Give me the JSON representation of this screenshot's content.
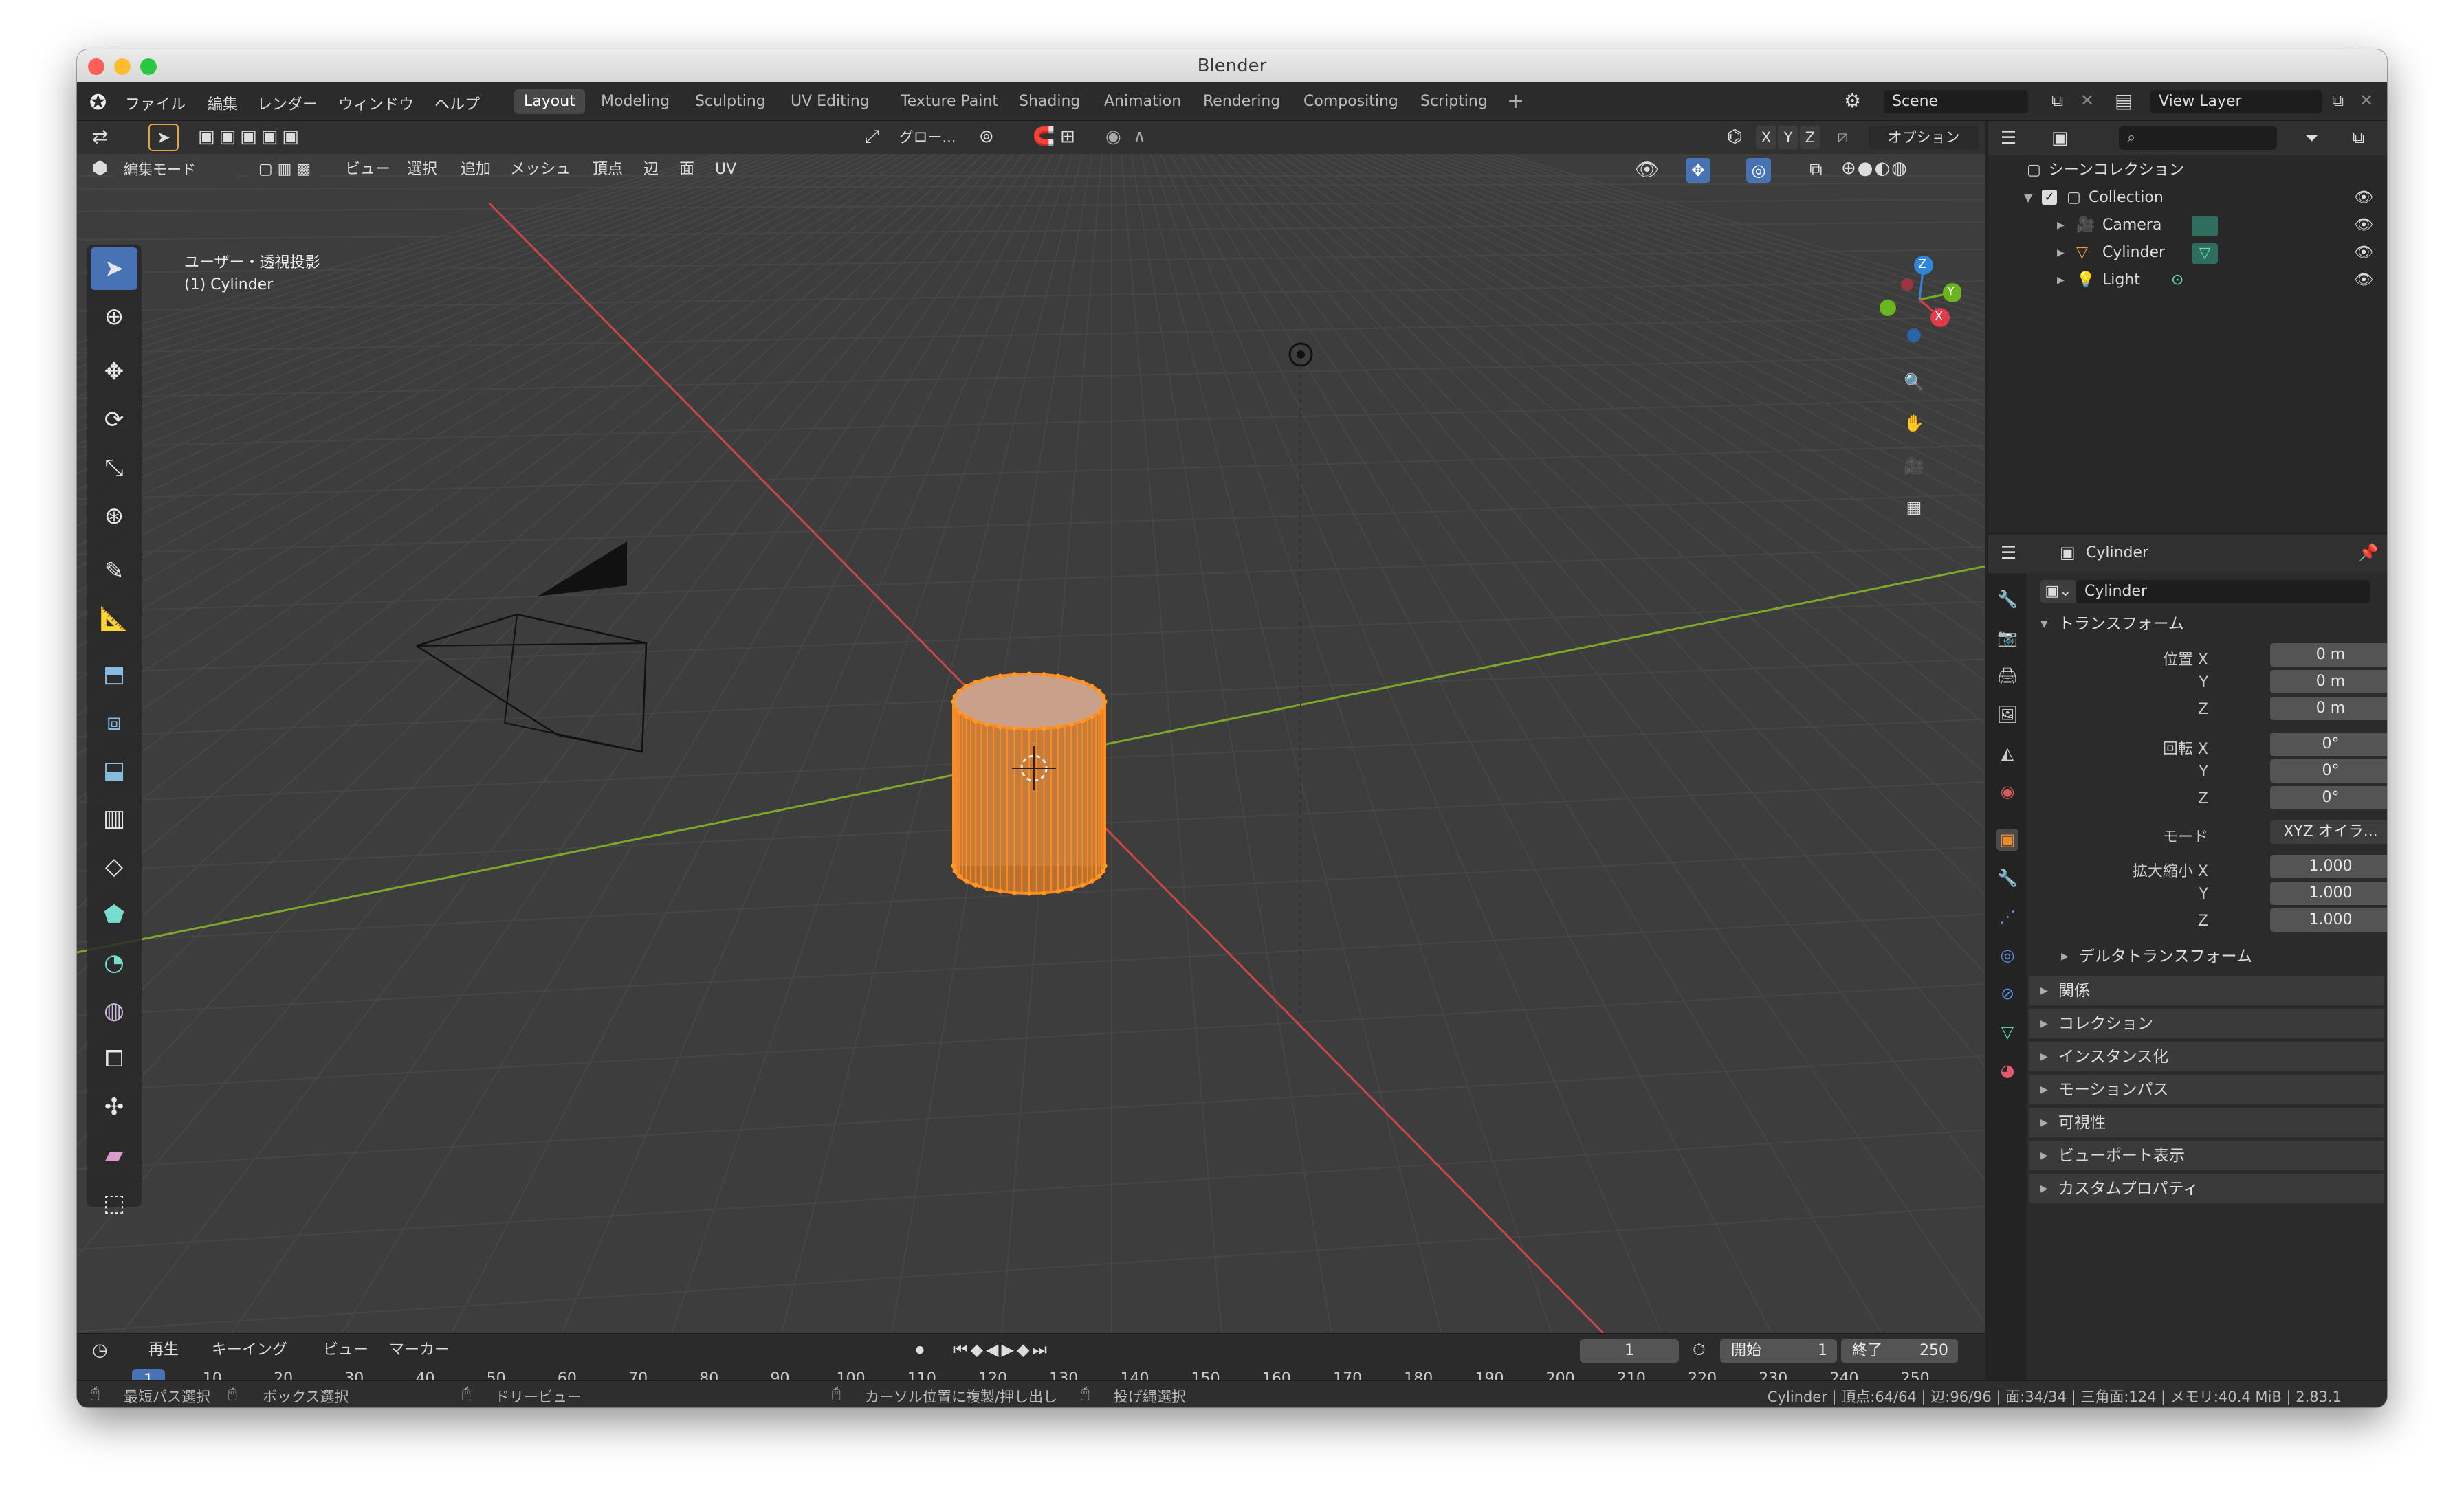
{
  "window": {
    "title": "Blender"
  },
  "menu": {
    "items": [
      "ファイル",
      "編集",
      "レンダー",
      "ウィンドウ",
      "ヘルプ"
    ]
  },
  "workspaces": [
    "Layout",
    "Modeling",
    "Sculpting",
    "UV Editing",
    "Texture Paint",
    "Shading",
    "Animation",
    "Rendering",
    "Compositing",
    "Scripting"
  ],
  "scene": {
    "name": "Scene",
    "view_layer": "View Layer"
  },
  "tool_header": {
    "orientation": "グロー...",
    "options": "オプション",
    "axes": [
      "X",
      "Y",
      "Z"
    ]
  },
  "viewport_header": {
    "mode": "編集モード",
    "menus": [
      "ビュー",
      "選択",
      "追加",
      "メッシュ",
      "頂点",
      "辺",
      "面",
      "UV"
    ]
  },
  "viewport": {
    "view_name": "ユーザー・透視投影",
    "object_label": "(1) Cylinder",
    "gizmo_axes": [
      "Z",
      "Y",
      "X"
    ]
  },
  "outliner": {
    "root": "シーンコレクション",
    "collection": "Collection",
    "objects": [
      "Camera",
      "Cylinder",
      "Light"
    ]
  },
  "properties": {
    "header_object": "Cylinder",
    "object_name": "Cylinder",
    "transform_title": "トランスフォーム",
    "location": {
      "label": "位置 X",
      "x": "0 m",
      "y": "0 m",
      "z": "0 m"
    },
    "rotation": {
      "label": "回転 X",
      "x": "0°",
      "y": "0°",
      "z": "0°"
    },
    "mode": {
      "label": "モード",
      "value": "XYZ オイラ..."
    },
    "scale": {
      "label": "拡大縮小 X",
      "x": "1.000",
      "y": "1.000",
      "z": "1.000"
    },
    "axis_y": "Y",
    "axis_z": "Z",
    "delta": "デルタトランスフォーム",
    "panels": [
      "関係",
      "コレクション",
      "インスタンス化",
      "モーションパス",
      "可視性",
      "ビューポート表示",
      "カスタムプロパティ"
    ]
  },
  "timeline": {
    "menus": [
      "再生",
      "キーイング",
      "ビュー",
      "マーカー"
    ],
    "current_frame": "1",
    "start_label": "開始",
    "start": "1",
    "end_label": "終了",
    "end": "250",
    "ticks": [
      "10",
      "20",
      "30",
      "40",
      "50",
      "60",
      "70",
      "80",
      "90",
      "100",
      "110",
      "120",
      "130",
      "140",
      "150",
      "160",
      "170",
      "180",
      "190",
      "200",
      "210",
      "220",
      "230",
      "240",
      "250"
    ]
  },
  "statusbar": {
    "hints": [
      "最短パス選択",
      "ボックス選択",
      "ドリービュー",
      "カーソル位置に複製/押し出し",
      "投げ縄選択"
    ],
    "info": "Cylinder | 頂点:64/64 | 辺:96/96 | 面:34/34 | 三角面:124 | メモリ:40.4 MiB | 2.83.1"
  },
  "colors": {
    "accent": "#4772b3",
    "selection": "#ff8a1f",
    "x_axis": "#c84646",
    "y_axis": "#7fa52a",
    "bg": "#3d3d3d"
  }
}
